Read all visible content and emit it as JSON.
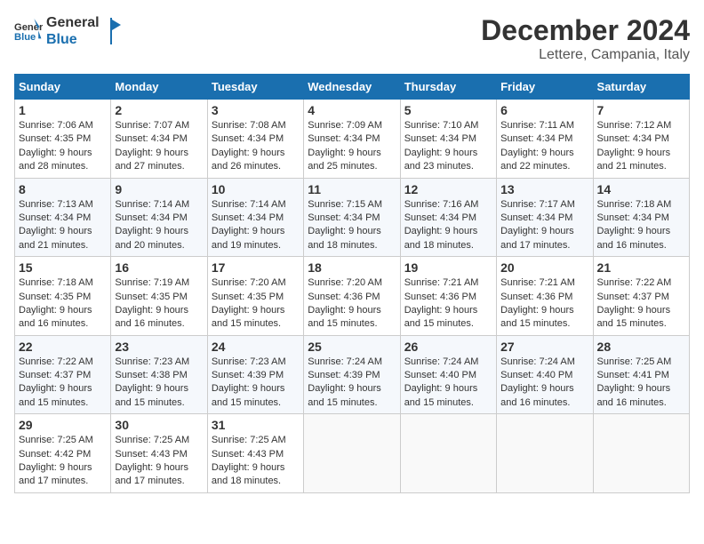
{
  "header": {
    "logo_general": "General",
    "logo_blue": "Blue",
    "month_year": "December 2024",
    "location": "Lettere, Campania, Italy"
  },
  "weekdays": [
    "Sunday",
    "Monday",
    "Tuesday",
    "Wednesday",
    "Thursday",
    "Friday",
    "Saturday"
  ],
  "weeks": [
    [
      {
        "day": "1",
        "sunrise": "Sunrise: 7:06 AM",
        "sunset": "Sunset: 4:35 PM",
        "daylight": "Daylight: 9 hours and 28 minutes."
      },
      {
        "day": "2",
        "sunrise": "Sunrise: 7:07 AM",
        "sunset": "Sunset: 4:34 PM",
        "daylight": "Daylight: 9 hours and 27 minutes."
      },
      {
        "day": "3",
        "sunrise": "Sunrise: 7:08 AM",
        "sunset": "Sunset: 4:34 PM",
        "daylight": "Daylight: 9 hours and 26 minutes."
      },
      {
        "day": "4",
        "sunrise": "Sunrise: 7:09 AM",
        "sunset": "Sunset: 4:34 PM",
        "daylight": "Daylight: 9 hours and 25 minutes."
      },
      {
        "day": "5",
        "sunrise": "Sunrise: 7:10 AM",
        "sunset": "Sunset: 4:34 PM",
        "daylight": "Daylight: 9 hours and 23 minutes."
      },
      {
        "day": "6",
        "sunrise": "Sunrise: 7:11 AM",
        "sunset": "Sunset: 4:34 PM",
        "daylight": "Daylight: 9 hours and 22 minutes."
      },
      {
        "day": "7",
        "sunrise": "Sunrise: 7:12 AM",
        "sunset": "Sunset: 4:34 PM",
        "daylight": "Daylight: 9 hours and 21 minutes."
      }
    ],
    [
      {
        "day": "8",
        "sunrise": "Sunrise: 7:13 AM",
        "sunset": "Sunset: 4:34 PM",
        "daylight": "Daylight: 9 hours and 21 minutes."
      },
      {
        "day": "9",
        "sunrise": "Sunrise: 7:14 AM",
        "sunset": "Sunset: 4:34 PM",
        "daylight": "Daylight: 9 hours and 20 minutes."
      },
      {
        "day": "10",
        "sunrise": "Sunrise: 7:14 AM",
        "sunset": "Sunset: 4:34 PM",
        "daylight": "Daylight: 9 hours and 19 minutes."
      },
      {
        "day": "11",
        "sunrise": "Sunrise: 7:15 AM",
        "sunset": "Sunset: 4:34 PM",
        "daylight": "Daylight: 9 hours and 18 minutes."
      },
      {
        "day": "12",
        "sunrise": "Sunrise: 7:16 AM",
        "sunset": "Sunset: 4:34 PM",
        "daylight": "Daylight: 9 hours and 18 minutes."
      },
      {
        "day": "13",
        "sunrise": "Sunrise: 7:17 AM",
        "sunset": "Sunset: 4:34 PM",
        "daylight": "Daylight: 9 hours and 17 minutes."
      },
      {
        "day": "14",
        "sunrise": "Sunrise: 7:18 AM",
        "sunset": "Sunset: 4:34 PM",
        "daylight": "Daylight: 9 hours and 16 minutes."
      }
    ],
    [
      {
        "day": "15",
        "sunrise": "Sunrise: 7:18 AM",
        "sunset": "Sunset: 4:35 PM",
        "daylight": "Daylight: 9 hours and 16 minutes."
      },
      {
        "day": "16",
        "sunrise": "Sunrise: 7:19 AM",
        "sunset": "Sunset: 4:35 PM",
        "daylight": "Daylight: 9 hours and 16 minutes."
      },
      {
        "day": "17",
        "sunrise": "Sunrise: 7:20 AM",
        "sunset": "Sunset: 4:35 PM",
        "daylight": "Daylight: 9 hours and 15 minutes."
      },
      {
        "day": "18",
        "sunrise": "Sunrise: 7:20 AM",
        "sunset": "Sunset: 4:36 PM",
        "daylight": "Daylight: 9 hours and 15 minutes."
      },
      {
        "day": "19",
        "sunrise": "Sunrise: 7:21 AM",
        "sunset": "Sunset: 4:36 PM",
        "daylight": "Daylight: 9 hours and 15 minutes."
      },
      {
        "day": "20",
        "sunrise": "Sunrise: 7:21 AM",
        "sunset": "Sunset: 4:36 PM",
        "daylight": "Daylight: 9 hours and 15 minutes."
      },
      {
        "day": "21",
        "sunrise": "Sunrise: 7:22 AM",
        "sunset": "Sunset: 4:37 PM",
        "daylight": "Daylight: 9 hours and 15 minutes."
      }
    ],
    [
      {
        "day": "22",
        "sunrise": "Sunrise: 7:22 AM",
        "sunset": "Sunset: 4:37 PM",
        "daylight": "Daylight: 9 hours and 15 minutes."
      },
      {
        "day": "23",
        "sunrise": "Sunrise: 7:23 AM",
        "sunset": "Sunset: 4:38 PM",
        "daylight": "Daylight: 9 hours and 15 minutes."
      },
      {
        "day": "24",
        "sunrise": "Sunrise: 7:23 AM",
        "sunset": "Sunset: 4:39 PM",
        "daylight": "Daylight: 9 hours and 15 minutes."
      },
      {
        "day": "25",
        "sunrise": "Sunrise: 7:24 AM",
        "sunset": "Sunset: 4:39 PM",
        "daylight": "Daylight: 9 hours and 15 minutes."
      },
      {
        "day": "26",
        "sunrise": "Sunrise: 7:24 AM",
        "sunset": "Sunset: 4:40 PM",
        "daylight": "Daylight: 9 hours and 15 minutes."
      },
      {
        "day": "27",
        "sunrise": "Sunrise: 7:24 AM",
        "sunset": "Sunset: 4:40 PM",
        "daylight": "Daylight: 9 hours and 16 minutes."
      },
      {
        "day": "28",
        "sunrise": "Sunrise: 7:25 AM",
        "sunset": "Sunset: 4:41 PM",
        "daylight": "Daylight: 9 hours and 16 minutes."
      }
    ],
    [
      {
        "day": "29",
        "sunrise": "Sunrise: 7:25 AM",
        "sunset": "Sunset: 4:42 PM",
        "daylight": "Daylight: 9 hours and 17 minutes."
      },
      {
        "day": "30",
        "sunrise": "Sunrise: 7:25 AM",
        "sunset": "Sunset: 4:43 PM",
        "daylight": "Daylight: 9 hours and 17 minutes."
      },
      {
        "day": "31",
        "sunrise": "Sunrise: 7:25 AM",
        "sunset": "Sunset: 4:43 PM",
        "daylight": "Daylight: 9 hours and 18 minutes."
      },
      null,
      null,
      null,
      null
    ]
  ]
}
